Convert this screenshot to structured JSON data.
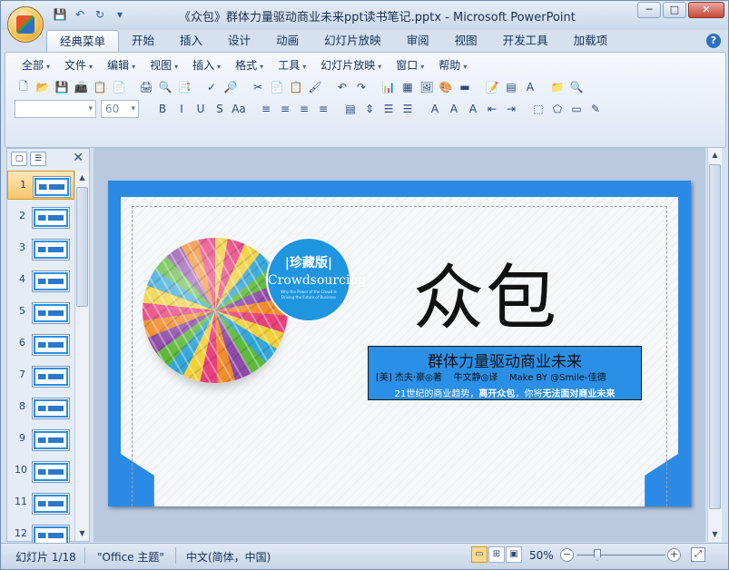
{
  "window": {
    "title": "《众包》群体力量驱动商业未来ppt读书笔记.pptx - Microsoft PowerPoint",
    "controls": {
      "minimize": "─",
      "maximize": "□",
      "close": "✕"
    }
  },
  "qat": {
    "save": "💾",
    "undo": "↶",
    "redo": "↻",
    "more": "▾"
  },
  "tabs": [
    "经典菜单",
    "开始",
    "插入",
    "设计",
    "动画",
    "幻灯片放映",
    "审阅",
    "视图",
    "开发工具",
    "加载项"
  ],
  "help": "?",
  "menubar": [
    "全部",
    "文件",
    "编辑",
    "视图",
    "插入",
    "格式",
    "工具",
    "幻灯片放映",
    "窗口",
    "帮助"
  ],
  "toolbar": {
    "row1": [
      "🗋",
      "📂",
      "💾",
      "📠",
      "📋",
      "📄",
      "",
      "🖨",
      "🔍",
      "📑",
      "",
      "✓",
      "🔎",
      "",
      "✂",
      "📄",
      "📋",
      "🖌",
      "",
      "↶",
      "↷",
      "",
      "📊",
      "▦",
      "🖼",
      "🎨",
      "▬",
      "",
      "📝",
      "▤",
      "A",
      "",
      "📁",
      "🔍"
    ],
    "font_name": "",
    "font_size": "60",
    "row2": [
      "B",
      "I",
      "U",
      "S",
      "Aa",
      "",
      "≡",
      "≡",
      "≡",
      "≡",
      "",
      "▤",
      "⇕",
      "☰",
      "☰",
      "",
      "A",
      "A",
      "A",
      "⇤",
      "⇥",
      "",
      "⬚",
      "⬠",
      "▭",
      "✎"
    ]
  },
  "slides_panel": {
    "tab_slides": "▢",
    "tab_outline": "☰",
    "close": "✕",
    "items": [
      "1",
      "2",
      "3",
      "4",
      "5",
      "6",
      "7",
      "8",
      "9",
      "10",
      "11",
      "12"
    ],
    "selected": "1",
    "scroll_up": "▲",
    "scroll_down": "▼"
  },
  "slide": {
    "badge_line1": "|珍藏版|",
    "badge_line2": "Crowdsourcing",
    "badge_line3": "Why the Power of the Crowd Is Driving the Future of Business",
    "main_title": "众包",
    "subtitle": "群体力量驱动商业未来",
    "credits": "[美] 杰夫·豪◎著    牛文静◎译    Make BY @Smile-佳德",
    "tagline_a": "21世纪的商业趋势，",
    "tagline_b": "离开众包",
    "tagline_c": "，你将",
    "tagline_d": "无法面对商业未来",
    "colors": {
      "frame": "#2b8ae6",
      "badge": "#1f95e0",
      "box": "#2a8fe6"
    }
  },
  "canvas_scroll": {
    "up": "▲",
    "down": "▼"
  },
  "statusbar": {
    "slide_info": "幻灯片 1/18",
    "theme": "\"Office 主题\"",
    "language": "中文(简体，中国)",
    "views": [
      "▭",
      "⊞",
      "▣"
    ],
    "zoom": "50%",
    "zoom_out": "−",
    "zoom_in": "+",
    "fit": "⤢"
  }
}
